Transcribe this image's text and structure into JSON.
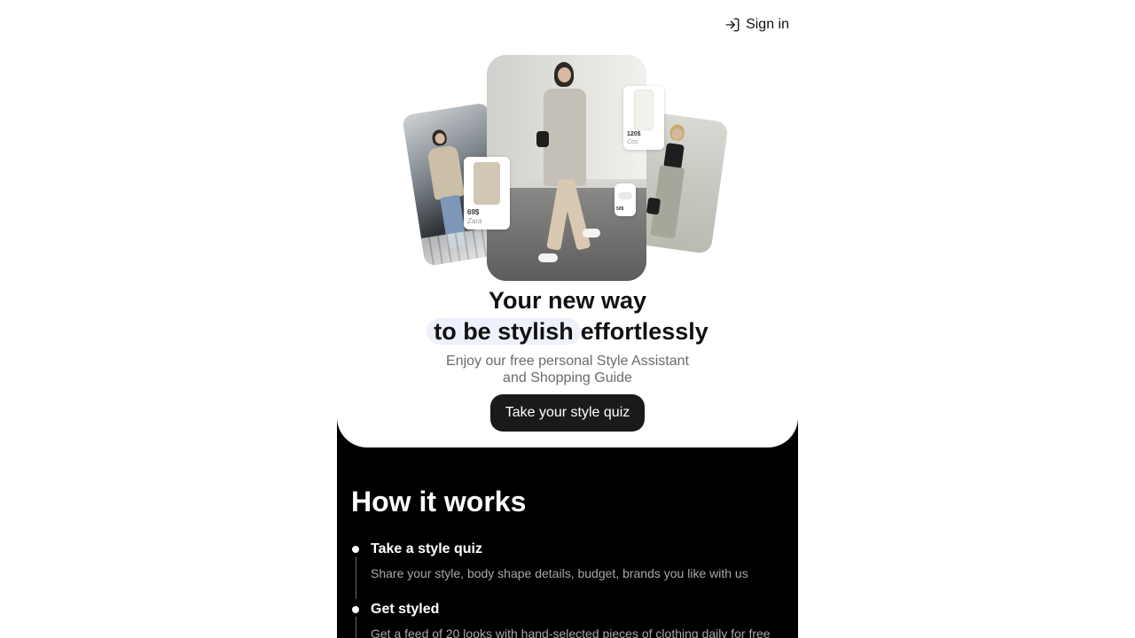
{
  "header": {
    "signin_label": "Sign in",
    "signin_icon": "sign-in-icon"
  },
  "hero": {
    "headline_line1": "Your new way",
    "headline_highlight": "to be stylish",
    "headline_rest": "effortlessly",
    "subtitle_line1": "Enjoy our free personal Style Assistant",
    "subtitle_line2": "and Shopping Guide",
    "cta_label": "Take your style quiz",
    "cards": [
      {
        "price": "69$",
        "brand": "Zara"
      },
      {
        "price": "120$",
        "brand": "Cos"
      },
      {
        "price": "50$",
        "brand": ""
      }
    ]
  },
  "how": {
    "title": "How it works",
    "steps": [
      {
        "title": "Take a style quiz",
        "desc": "Share your style, body shape details, budget, brands you like with us"
      },
      {
        "title": "Get styled",
        "desc": "Get a feed of 20 looks with hand-selected pieces of clothing daily for free"
      }
    ]
  },
  "colors": {
    "accent_highlight": "#eef0fb",
    "cta_bg": "#1a1a1a",
    "section_bg": "#000000"
  }
}
